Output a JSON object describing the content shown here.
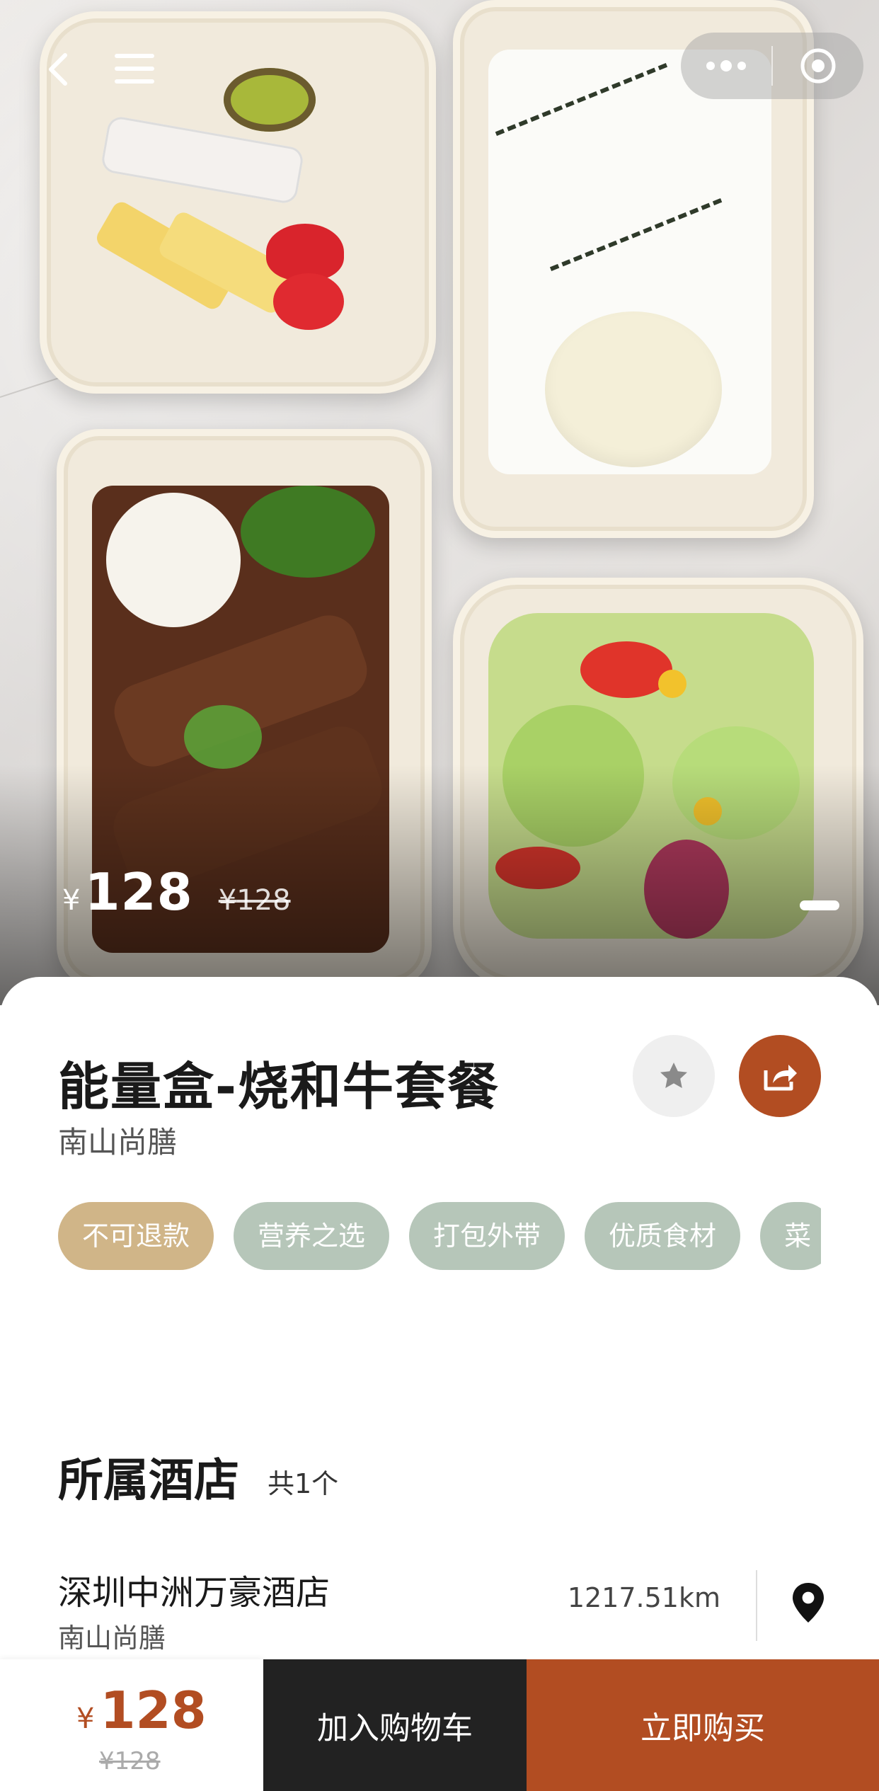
{
  "hero": {
    "currency": "¥",
    "price": "128",
    "original_currency": "¥",
    "original_price": "128",
    "image": "food-boxes-photo"
  },
  "nav": {
    "back_icon": "chevron-left-icon",
    "menu_icon": "hamburger-icon",
    "more_icon": "more-dots-icon",
    "target_icon": "target-icon"
  },
  "product": {
    "title": "能量盒-烧和牛套餐",
    "subtitle": "南山尚膳",
    "tags": [
      "不可退款",
      "营养之选",
      "打包外带",
      "优质食材",
      "菜"
    ]
  },
  "hotel_section": {
    "title": "所属酒店",
    "count": "共1个",
    "hotels": [
      {
        "name": "深圳中洲万豪酒店",
        "restaurant": "南山尚膳",
        "distance": "1217.51km"
      }
    ]
  },
  "bottom_bar": {
    "currency": "¥",
    "price": "128",
    "original_price": "¥128",
    "add_to_cart": "加入购物车",
    "buy_now": "立即购买"
  },
  "colors": {
    "accent": "#b24d22",
    "tag_gold": "#d0b588",
    "tag_green": "#b6c6b9",
    "cart_button": "#222222"
  }
}
